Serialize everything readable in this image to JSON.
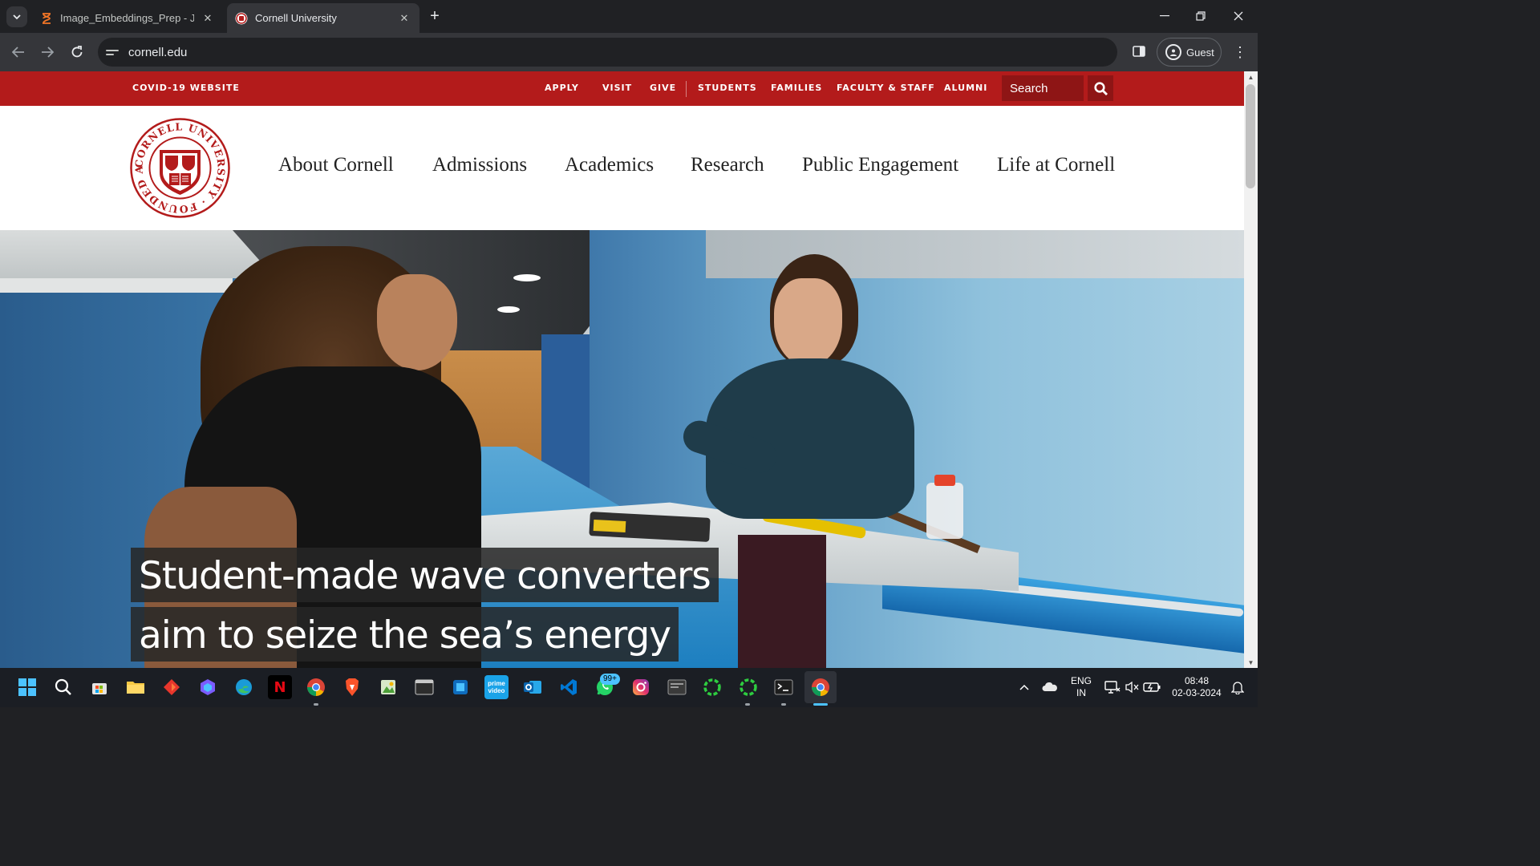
{
  "browser": {
    "tabs": [
      {
        "title": "Image_Embeddings_Prep - Jupyter",
        "active": false,
        "icon": "hourglass-icon"
      },
      {
        "title": "Cornell University",
        "active": true,
        "icon": "cornell-favicon"
      }
    ],
    "url": "cornell.edu",
    "profile_label": "Guest"
  },
  "site": {
    "utility": {
      "covid": "COVID-19 WEBSITE",
      "links": [
        "APPLY",
        "VISIT",
        "GIVE",
        "STUDENTS",
        "FAMILIES",
        "FACULTY & STAFF",
        "ALUMNI"
      ],
      "search_placeholder": "Search"
    },
    "seal": {
      "ring_text": "CORNELL UNIVERSITY · FOUNDED A.D. 1865"
    },
    "nav": [
      "About Cornell",
      "Admissions",
      "Academics",
      "Research",
      "Public Engagement",
      "Life at Cornell"
    ],
    "hero": {
      "headline_line1": "Student-made wave converters",
      "headline_line2": "aim to seize the sea’s energy"
    }
  },
  "taskbar": {
    "apps": [
      "windows-start-icon",
      "search-icon",
      "microsoft-store-icon",
      "file-explorer-icon",
      "affinity-icon",
      "copilot-icon",
      "edge-icon",
      "netflix-icon",
      "chrome-icon",
      "brave-icon",
      "paint-icon",
      "terminal-window-icon",
      "windows-app-icon",
      "prime-video-icon",
      "outlook-icon",
      "vscode-icon",
      "whatsapp-icon",
      "instagram-icon",
      "app-window-icon",
      "spinner-app-icon",
      "spinner-app-icon-2",
      "terminal-icon",
      "chrome-active-icon"
    ],
    "whatsapp_badge": "99+",
    "language_top": "ENG",
    "language_bottom": "IN",
    "time": "08:48",
    "date": "02-03-2024"
  },
  "colors": {
    "cornell_red": "#b31b1b",
    "cornell_dark_red": "#8e1515",
    "chrome_dark": "#202124",
    "taskbar": "#1b1e24"
  }
}
